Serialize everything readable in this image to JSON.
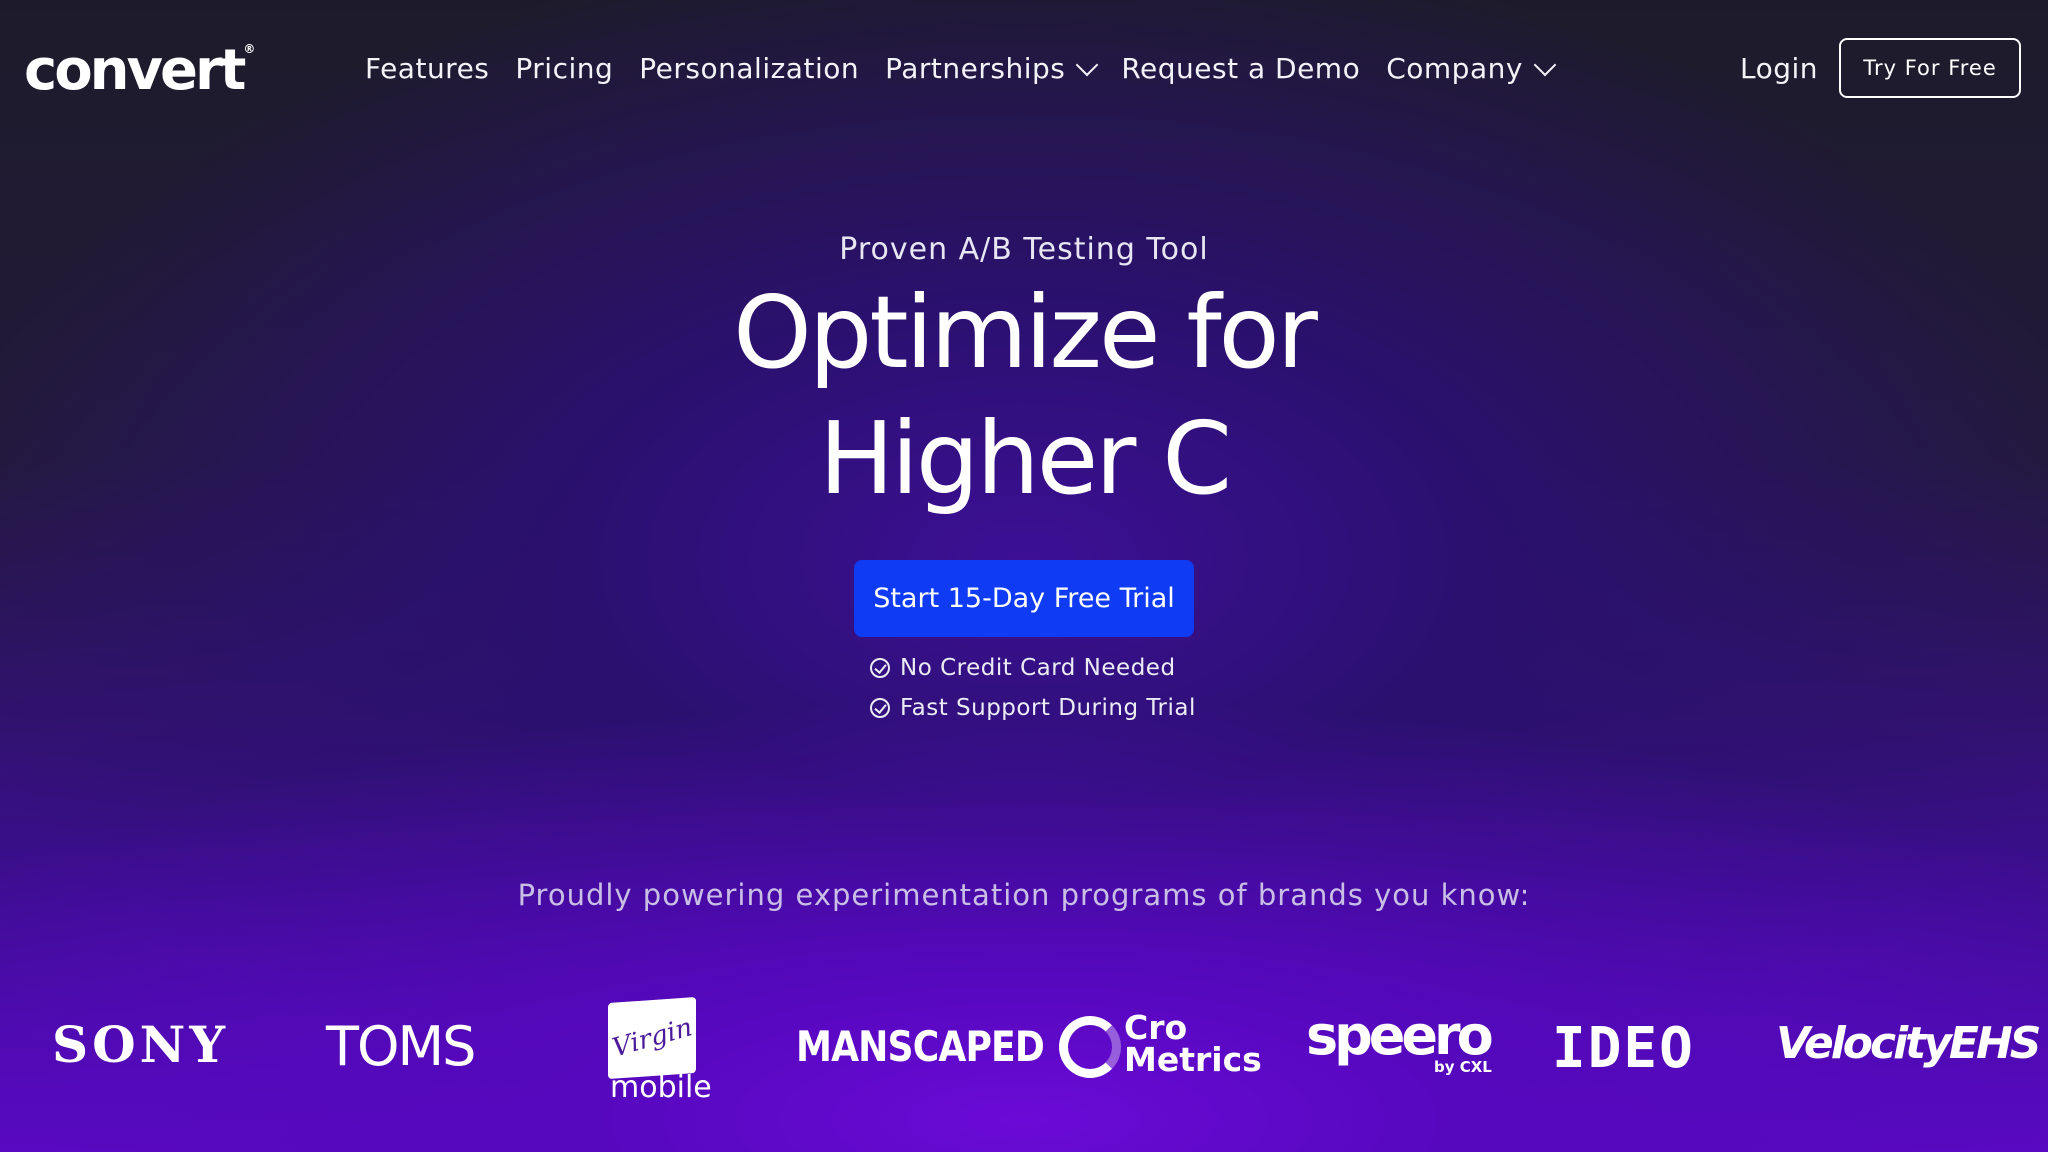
{
  "nav": {
    "logo": "convert",
    "logo_mark": "®",
    "links": [
      {
        "label": "Features",
        "dropdown": false
      },
      {
        "label": "Pricing",
        "dropdown": false
      },
      {
        "label": "Personalization",
        "dropdown": false
      },
      {
        "label": "Partnerships",
        "dropdown": true
      },
      {
        "label": "Request a Demo",
        "dropdown": false
      },
      {
        "label": "Company",
        "dropdown": true
      }
    ],
    "login": "Login",
    "try_button": "Try For Free"
  },
  "hero": {
    "eyebrow": "Proven A/B Testing Tool",
    "headline_line1": "Optimize for",
    "headline_line2": "Higher C",
    "cta": "Start 15-Day Free Trial",
    "checks": [
      "No Credit Card Needed",
      "Fast Support During Trial"
    ]
  },
  "brands": {
    "intro": "Proudly powering experimentation programs of brands you know:",
    "sony": "SONY",
    "toms": "TOMS",
    "virgin_script": "Virgin",
    "virgin_mobile": "mobile",
    "manscaped": "MANSCAPED",
    "cro_line1": "Cro",
    "cro_line2": "Metrics",
    "speero": "speero",
    "speero_by": "by CXL",
    "ideo": "IDEO",
    "velocity": "VelocityEHS"
  },
  "colors": {
    "cta": "#0f3bf5",
    "background_top": "#1d1b2b",
    "background_glow": "#6a0ad6"
  }
}
